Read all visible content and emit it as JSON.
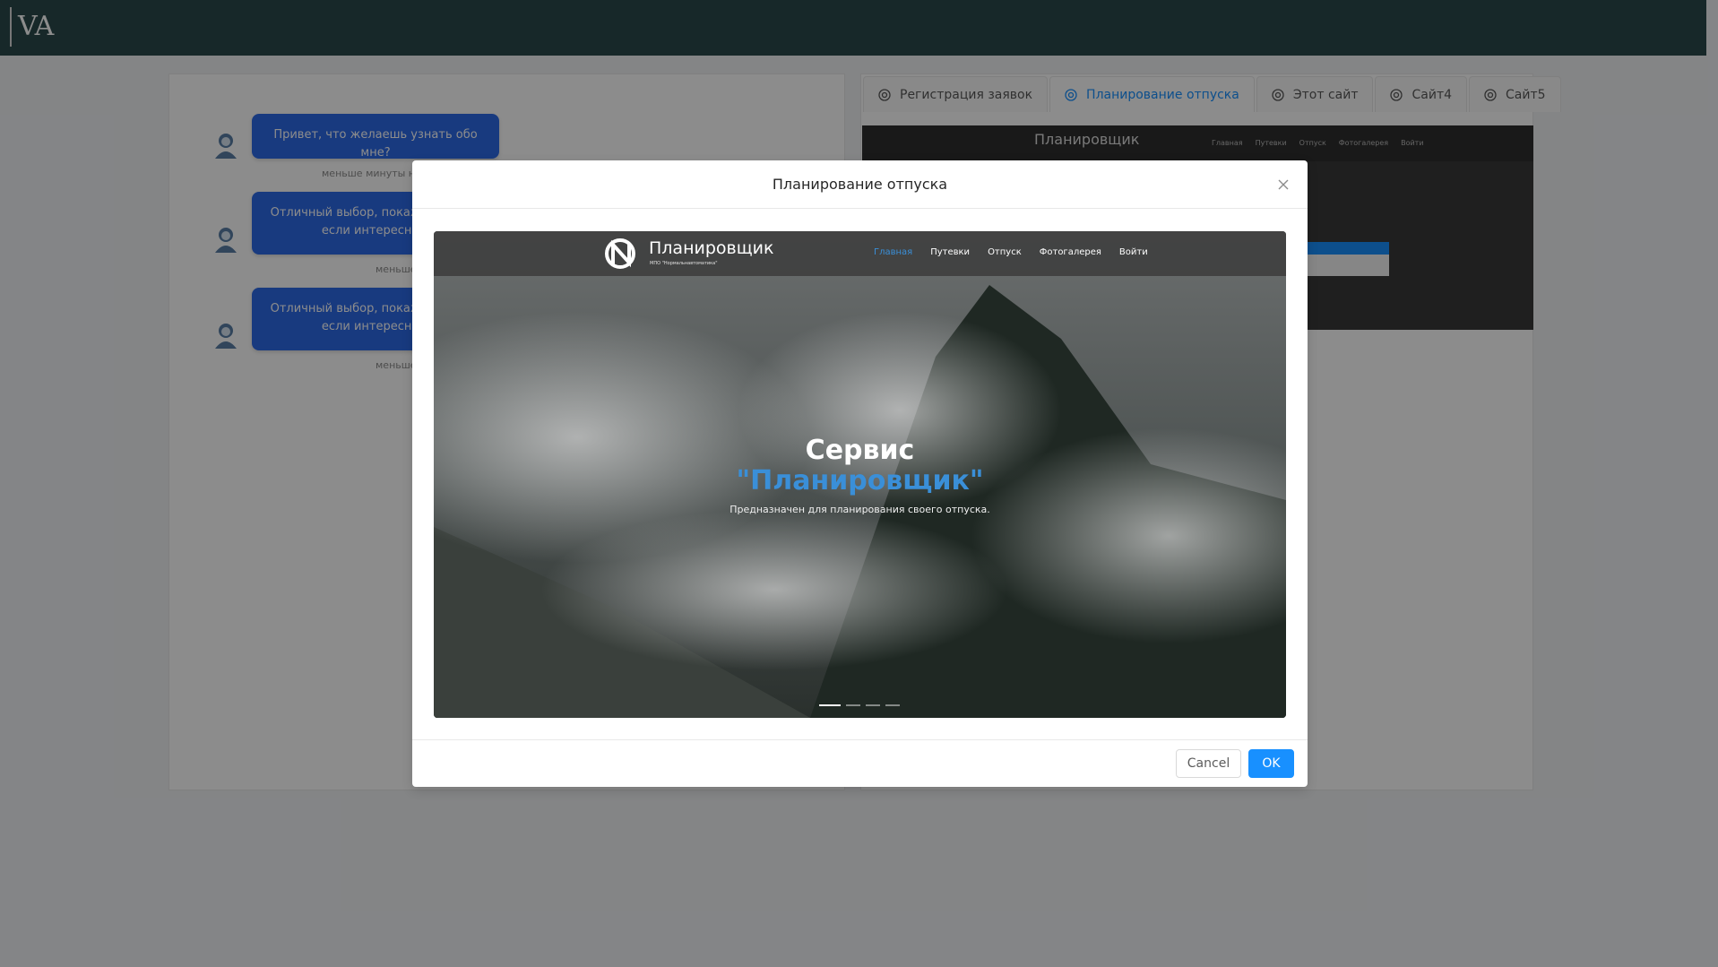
{
  "app": {
    "logo_text": "VA"
  },
  "chat": {
    "messages": [
      {
        "text": "Привет, что желаешь узнать обо мне?",
        "time": "меньше минуты назад"
      },
      {
        "text": "Отличный выбор, покажу тебе несколько проектов, если интересно, нажми на вкладку",
        "time": "меньше минуты назад"
      },
      {
        "text": "Отличный выбор, покажу тебе несколько проектов, если интересно, нажми на вкладку",
        "time": "меньше минуты назад"
      }
    ]
  },
  "tabs": [
    {
      "label": "Регистрация заявок",
      "icon": "chrome-icon"
    },
    {
      "label": "Планирование отпуска",
      "icon": "chrome-icon",
      "active": true
    },
    {
      "label": "Этот сайт",
      "icon": "chrome-icon"
    },
    {
      "label": "Сайт4",
      "icon": "chrome-icon"
    },
    {
      "label": "Сайт5",
      "icon": "chrome-icon"
    }
  ],
  "preview": {
    "title": "Планировщик",
    "links": [
      "Главная",
      "Путевки",
      "Отпуск",
      "Фотогалерея",
      "Войти"
    ]
  },
  "modal": {
    "title": "Планирование отпуска",
    "site": {
      "brand": "Планировщик",
      "brand_sub": "МПО \"Нормальнавтоматика\"",
      "nav": [
        "Главная",
        "Путевки",
        "Отпуск",
        "Фотогалерея",
        "Войти"
      ],
      "active_nav": "Главная",
      "hero_line1": "Сервис",
      "hero_line2": "\"Планировщик\"",
      "hero_text": "Предназначен для планирования своего отпуска.",
      "slide_count": 4,
      "active_slide": 1
    },
    "cancel_label": "Cancel",
    "ok_label": "OK"
  },
  "colors": {
    "topbar": "#2b4a4b",
    "bubble": "#2d6ae8",
    "primary": "#1890ff",
    "hero_accent": "#3a8fd8"
  }
}
